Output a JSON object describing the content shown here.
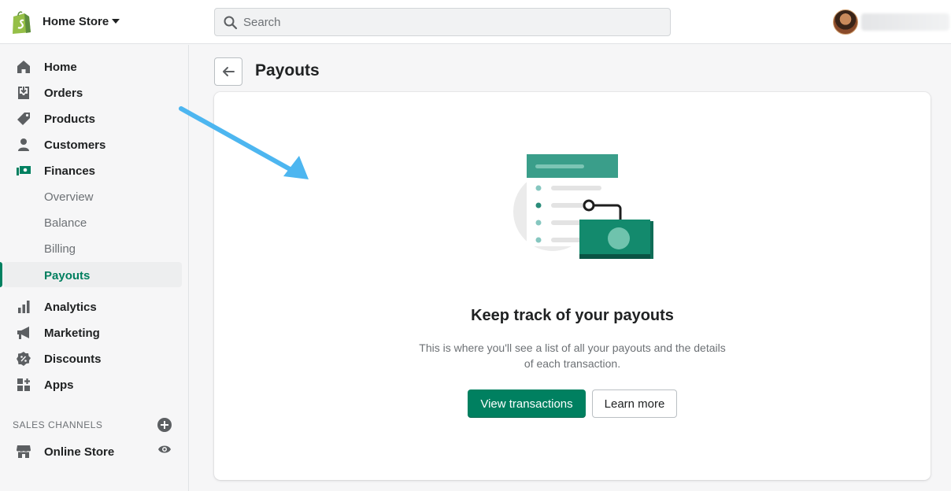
{
  "topbar": {
    "store_name": "Home Store",
    "search_placeholder": "Search"
  },
  "sidebar": {
    "items": [
      {
        "label": "Home",
        "icon": "home-icon"
      },
      {
        "label": "Orders",
        "icon": "orders-icon"
      },
      {
        "label": "Products",
        "icon": "tag-icon"
      },
      {
        "label": "Customers",
        "icon": "person-icon"
      },
      {
        "label": "Finances",
        "icon": "finances-icon"
      }
    ],
    "finances_sub": [
      {
        "label": "Overview"
      },
      {
        "label": "Balance"
      },
      {
        "label": "Billing"
      },
      {
        "label": "Payouts",
        "active": true
      }
    ],
    "items2": [
      {
        "label": "Analytics",
        "icon": "analytics-icon"
      },
      {
        "label": "Marketing",
        "icon": "megaphone-icon"
      },
      {
        "label": "Discounts",
        "icon": "discount-icon"
      },
      {
        "label": "Apps",
        "icon": "apps-icon"
      }
    ],
    "sales_channels_title": "SALES CHANNELS",
    "online_store": "Online Store"
  },
  "page": {
    "title": "Payouts"
  },
  "empty_state": {
    "heading": "Keep track of your payouts",
    "text": "This is where you'll see a list of all your payouts and the details of each transaction.",
    "primary_button": "View transactions",
    "secondary_button": "Learn more"
  },
  "colors": {
    "brand_green": "#008060",
    "active_text": "#007f5f",
    "annotation_arrow": "#4db6f0"
  }
}
